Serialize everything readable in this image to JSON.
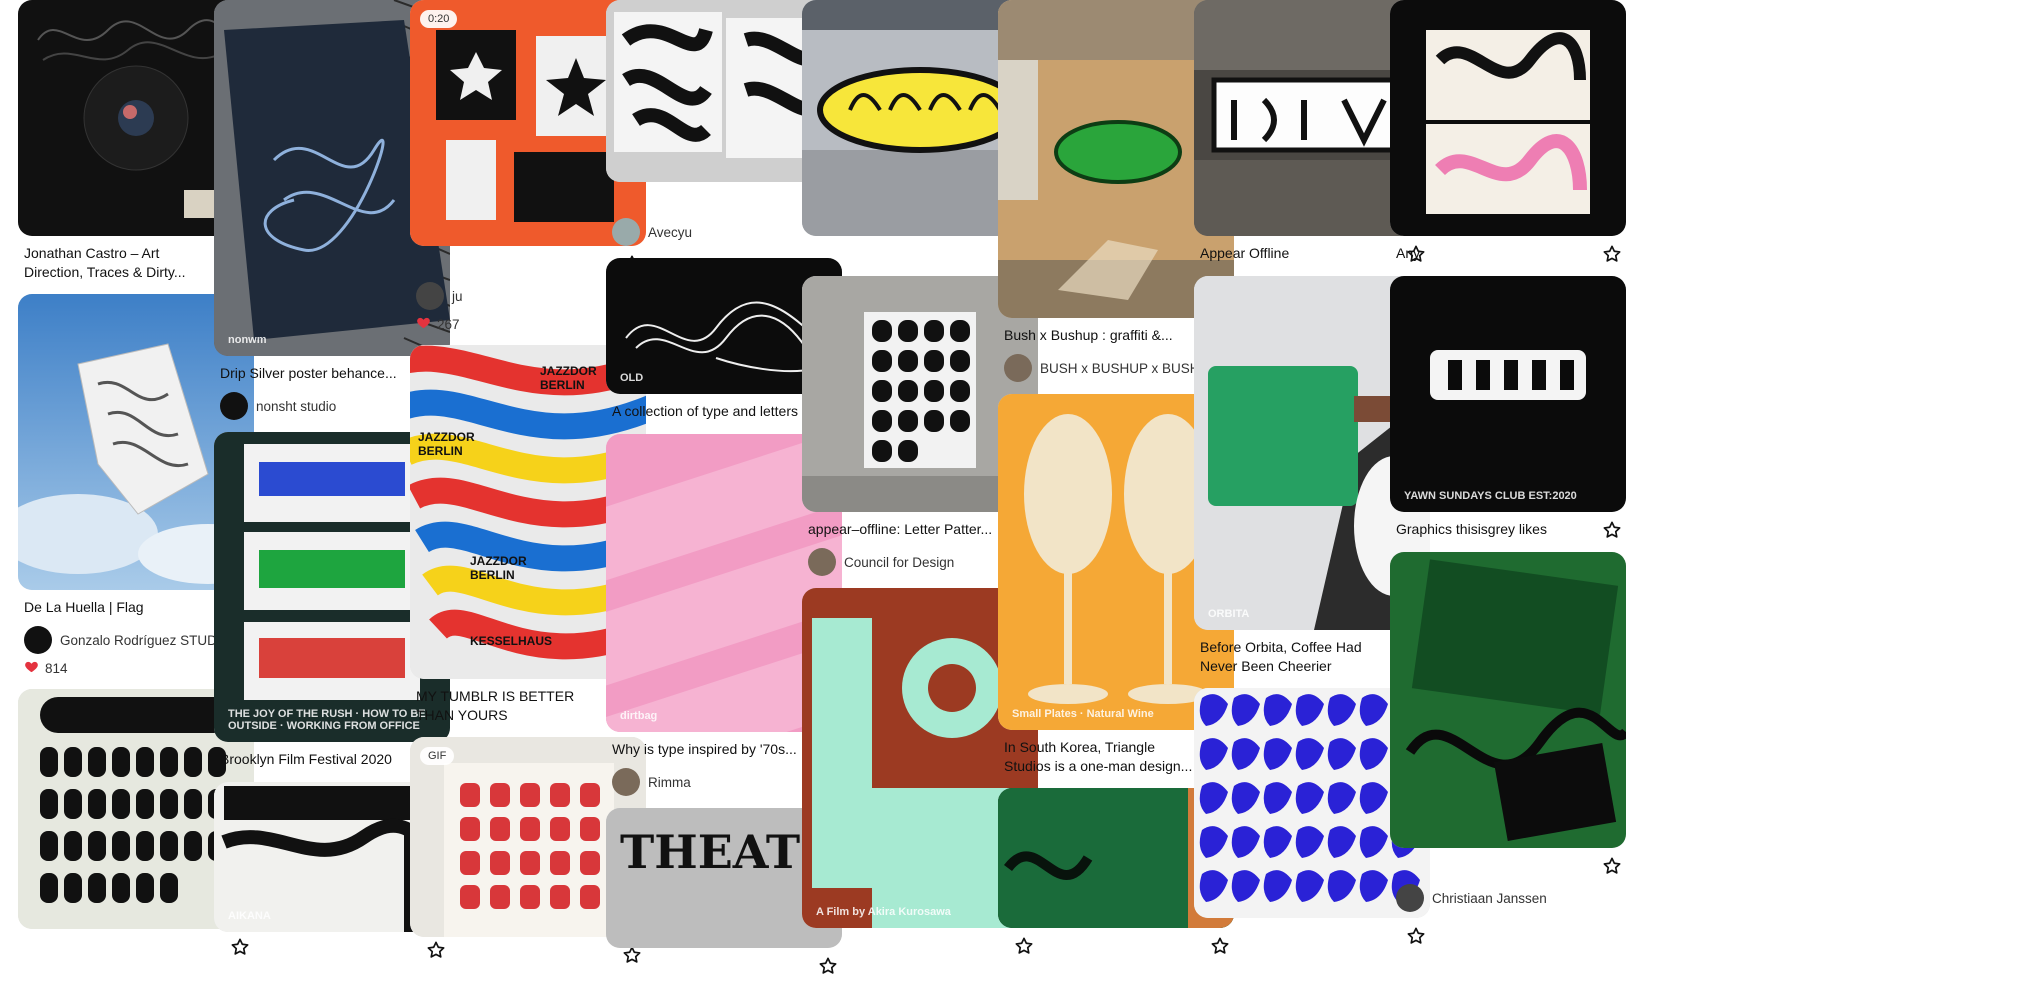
{
  "columns": [
    [
      {
        "title": "Jonathan Castro – Art Direction, Traces & Dirty...",
        "image_h": 236
      },
      {
        "title": "De La Huella | Flag",
        "image_h": 296,
        "author": "Gonzalo Rodríguez STUDIO",
        "likes": "814"
      },
      {
        "title": "",
        "image_h": 240
      }
    ],
    [
      {
        "title": "Drip Silver poster behance...",
        "image_h": 356,
        "author": "nonsht studio",
        "image_text": "nonwm"
      },
      {
        "title": "Brooklyn Film Festival 2020",
        "image_h": 310,
        "image_text": "THE JOY OF THE RUSH · HOW TO BE OUTSIDE · WORKING FROM OFFICE"
      },
      {
        "title": "",
        "image_h": 150,
        "image_text": "AIKANA"
      }
    ],
    [
      {
        "title": "",
        "image_h": 246,
        "author": "ju",
        "likes": "267",
        "badge": "0:20"
      },
      {
        "title": "MY TUMBLR IS BETTER THAN YOURS",
        "image_h": 334
      },
      {
        "title": "",
        "image_h": 200,
        "badge": "GIF"
      }
    ],
    [
      {
        "title": "",
        "image_h": 182,
        "author": "Avecyu"
      },
      {
        "title": "A collection of type and letters",
        "image_h": 136,
        "image_text": "OLD"
      },
      {
        "title": "Why is type inspired by '70s...",
        "image_h": 298,
        "author": "Rimma",
        "image_text": "dirtbag"
      },
      {
        "title": "",
        "image_h": 140
      }
    ],
    [
      {
        "title": "",
        "image_h": 236
      },
      {
        "title": "appear–offline: Letter Patter...",
        "image_h": 236,
        "author": "Council for Design"
      },
      {
        "title": "",
        "image_h": 340,
        "image_text": "A Film by Akira Kurosawa"
      }
    ],
    [
      {
        "title": "Bush x Bushup : graffiti &...",
        "image_h": 318,
        "author": "BUSH x BUSHUP x BUSH U..."
      },
      {
        "title": "In South Korea, Triangle Studios is a one-man design...",
        "image_h": 336,
        "image_text": "Small Plates · Natural Wine"
      },
      {
        "title": "",
        "image_h": 140
      }
    ],
    [
      {
        "title": "Appear Offline",
        "image_h": 236
      },
      {
        "title": "Before Orbita, Coffee Had Never Been Cheerier",
        "image_h": 354,
        "image_text": "ORBITA"
      },
      {
        "title": "",
        "image_h": 230
      }
    ],
    [
      {
        "title": "Any",
        "image_h": 236
      },
      {
        "title": "Graphics thisisgrey likes",
        "image_h": 236,
        "image_text": "YAWN SUNDAYS CLUB EST:2020"
      },
      {
        "title": "",
        "image_h": 296,
        "author": "Christiaan Janssen"
      }
    ]
  ]
}
